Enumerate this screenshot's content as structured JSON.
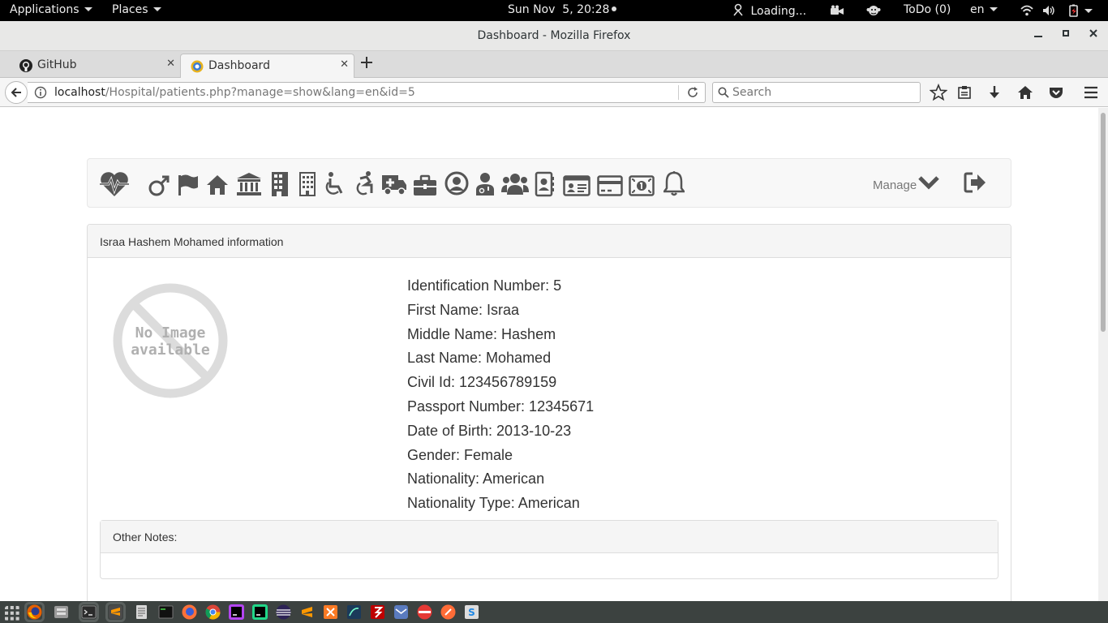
{
  "topbar": {
    "applications": "Applications",
    "places": "Places",
    "clock": "Sun Nov  5, 20:28",
    "loading": "Loading...",
    "todo": "ToDo (0)",
    "lang": "en"
  },
  "window": {
    "title": "Dashboard - Mozilla Firefox"
  },
  "tabs": [
    {
      "label": "GitHub",
      "icon": "github-icon"
    },
    {
      "label": "Dashboard",
      "icon": "site-favicon-icon"
    }
  ],
  "navbar": {
    "url_host": "localhost",
    "url_path": "/Hospital/patients.php?manage=show&lang=en&id=5",
    "search_placeholder": "Search"
  },
  "appnav": {
    "icons": [
      "heartbeat-icon",
      "male-icon",
      "flag-icon",
      "home-icon",
      "bank-icon",
      "building-icon",
      "building-outline-icon",
      "wheelchair-icon",
      "accessible-icon",
      "ambulance-icon",
      "briefcase-icon",
      "user-circle-icon",
      "user-md-icon",
      "users-icon",
      "address-book-icon",
      "id-card-icon",
      "credit-card-icon",
      "money-icon",
      "bell-icon"
    ],
    "manage_label": "Manage"
  },
  "patient": {
    "panel_title": "Israa Hashem Mohamed information",
    "no_image_line1": "No Image",
    "no_image_line2": "available",
    "fields": [
      "Identification Number: 5",
      "First Name: Israa",
      "Middle Name: Hashem",
      "Last Name: Mohamed",
      "Civil Id: 123456789159",
      "Passport Number: 12345671",
      "Date of Birth: 2013-10-23",
      "Gender: Female",
      "Nationality: American",
      "Nationality Type: American"
    ],
    "notes_label": "Other Notes:",
    "notes_value": ""
  },
  "taskbar": {
    "apps": [
      "show-apps-icon",
      "firefox-icon",
      "files-icon",
      "terminal-icon",
      "sublime-text-icon",
      "text-editor-icon",
      "terminal-dark-icon",
      "firefox-alt-icon",
      "chrome-icon",
      "phpstorm-icon",
      "pycharm-icon",
      "eclipse-icon",
      "sublime-alt-icon",
      "xampp-icon",
      "mysql-workbench-icon",
      "filezilla-icon",
      "kmail-icon",
      "unity-icon",
      "postman-icon",
      "sublime-merge-icon"
    ]
  },
  "colors": {
    "topbar_bg": "#000000",
    "panel_heading_bg": "#f5f5f5",
    "nav_icon": "#555555",
    "taskbar_bg": "#3c4240"
  }
}
